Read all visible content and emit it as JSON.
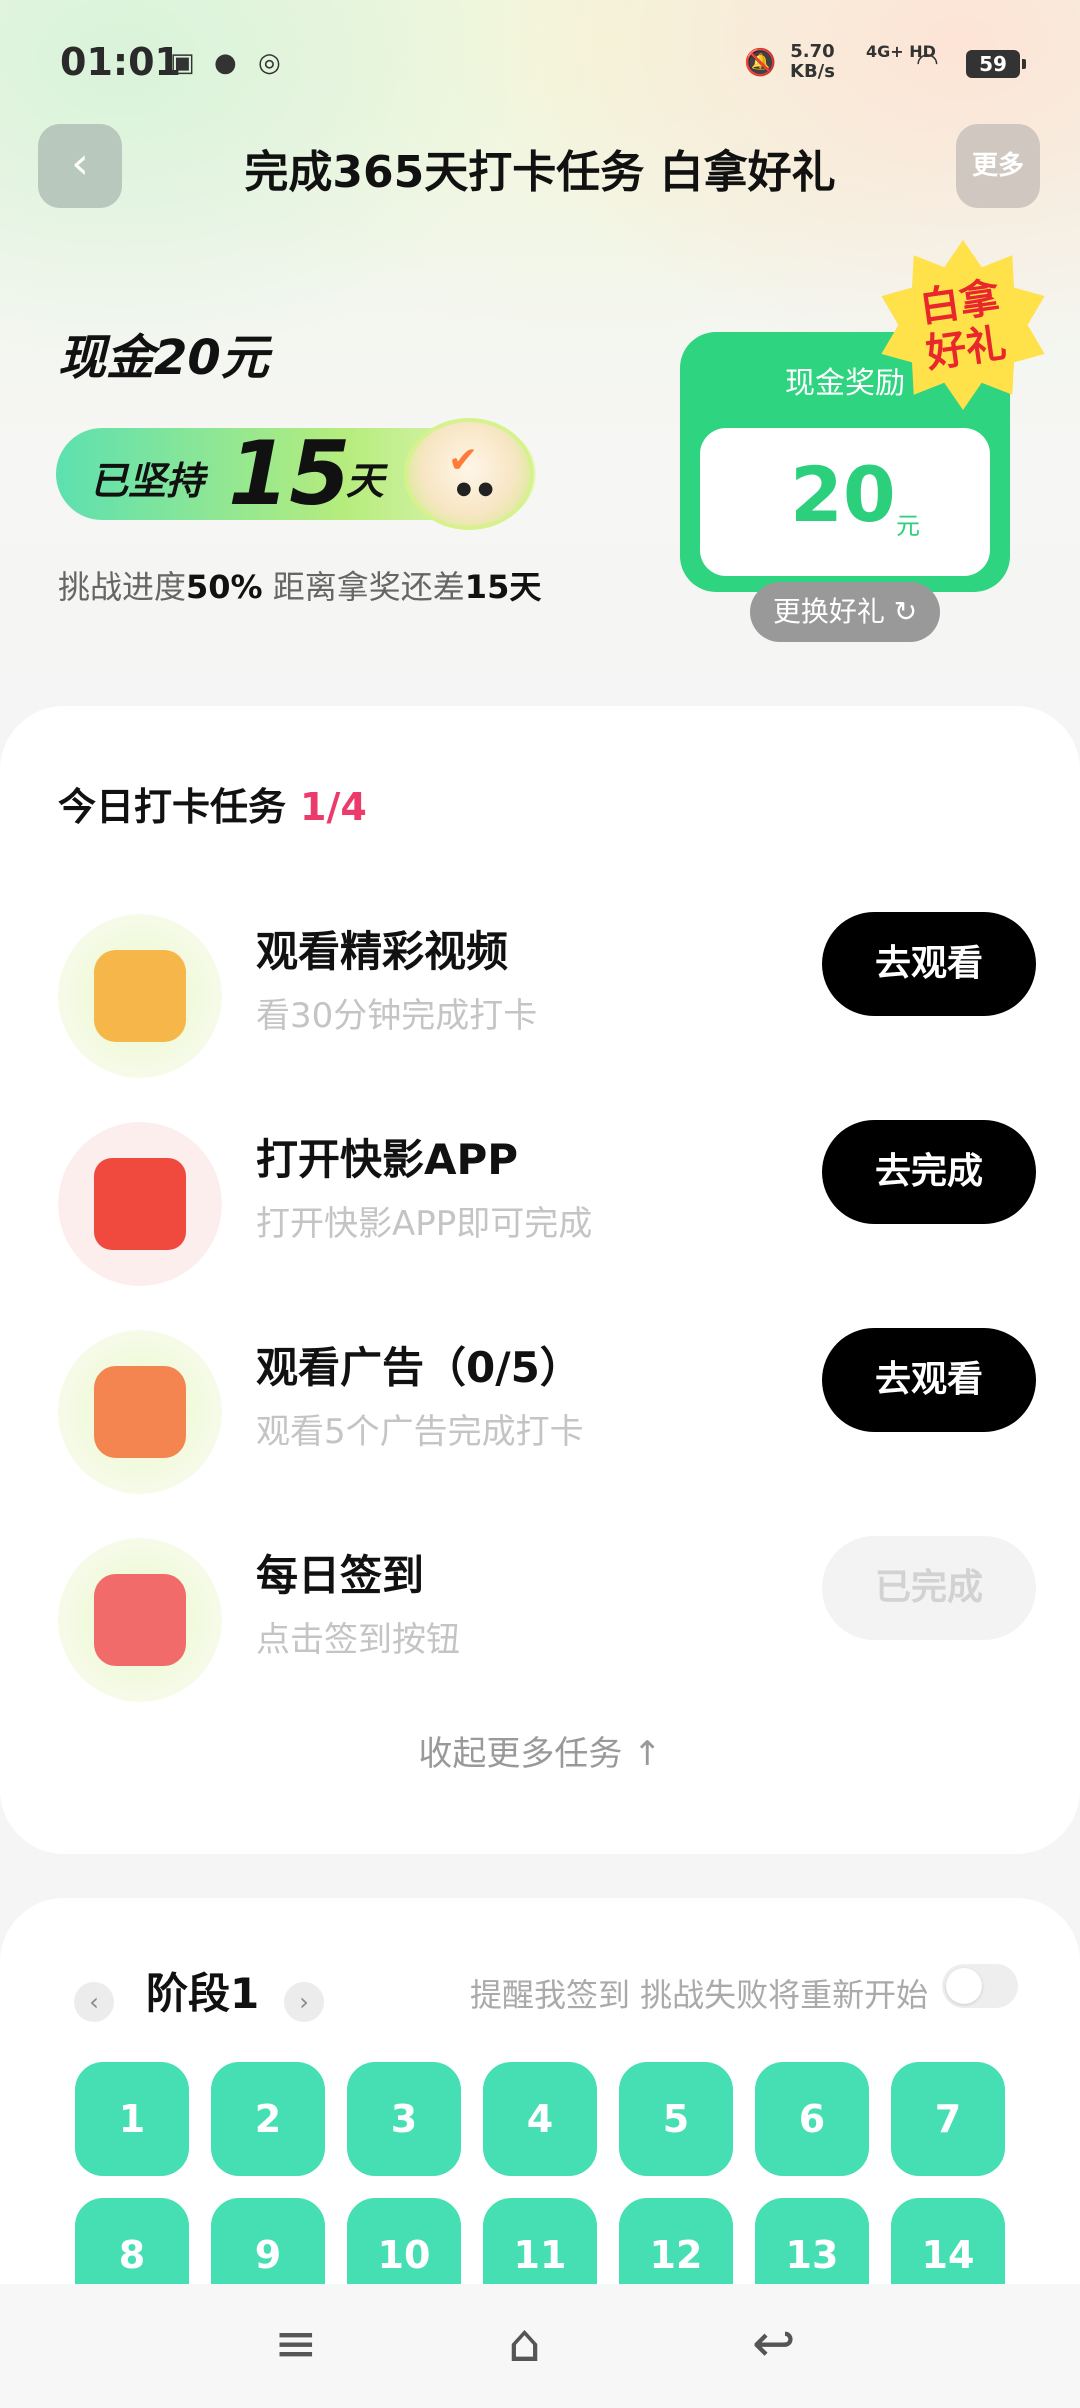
{
  "status": {
    "time": "01:01",
    "speed_value": "5.70",
    "speed_unit": "KB/s",
    "network": "4G+ HD",
    "battery": "59"
  },
  "header": {
    "back_glyph": "‹",
    "title": "完成365天打卡任务 白拿好礼",
    "more_label": "更多"
  },
  "hero": {
    "cash_title": "现金20元",
    "streak_prefix": "已坚持",
    "streak_days": "15",
    "streak_suffix": "天",
    "progress_prefix": "挑战进度",
    "progress_percent": "50%",
    "progress_mid": " 距离拿奖还差",
    "progress_remaining": "15天",
    "reward_label": "现金奖励",
    "reward_amount": "20",
    "reward_unit": "元",
    "badge_text": "白拿好礼",
    "swap_label": "更换好礼 ↻"
  },
  "tasks": {
    "heading": "今日打卡任务",
    "count": "1/4",
    "items": [
      {
        "name": "观看精彩视频",
        "sub": "看30分钟完成打卡",
        "button": "去观看",
        "icon": "video-icon",
        "color": "#f7b64a"
      },
      {
        "name": "打开快影APP",
        "sub": "打开快影APP即可完成",
        "button": "去完成",
        "icon": "camera-icon",
        "color": "#f04a3f"
      },
      {
        "name": "观看广告（0/5）",
        "sub": "观看5个广告完成打卡",
        "button": "去观看",
        "icon": "ad-icon",
        "color": "#f58550"
      },
      {
        "name": "每日签到",
        "sub": "点击签到按钮",
        "button": "已完成",
        "icon": "calendar-icon",
        "color": "#f26b6b"
      }
    ],
    "collapse_label": "收起更多任务 ↑"
  },
  "stage": {
    "title": "阶段1",
    "prev_glyph": "‹",
    "next_glyph": "›",
    "remind_text": "提醒我签到 挑战失败将重新开始",
    "days": [
      "1",
      "2",
      "3",
      "4",
      "5",
      "6",
      "7",
      "8",
      "9",
      "10",
      "11",
      "12",
      "13",
      "14"
    ]
  },
  "navbar": {
    "menu": "≡",
    "home": "⌂",
    "back": "↩"
  }
}
